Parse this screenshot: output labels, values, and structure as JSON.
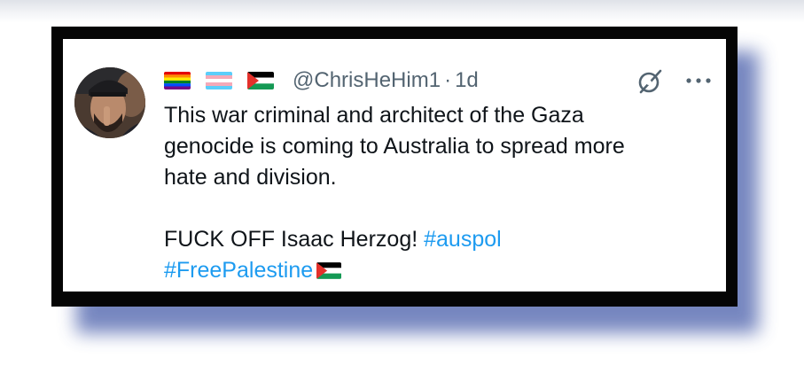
{
  "tweet": {
    "handle": "@ChrisHeHim1",
    "separator": "·",
    "time": "1d",
    "name_flags": [
      "rainbow-pride-flag-icon",
      "transgender-flag-icon",
      "palestine-flag-icon"
    ],
    "lines": [
      "This war criminal and architect of the Gaza",
      "genocide is coming to Australia to spread more",
      "hate and division."
    ],
    "line5_text": "FUCK OFF Isaac Herzog! ",
    "hashtag_1": "#auspol",
    "hashtag_2": "#FreePalestine",
    "trailing_flag": "palestine-flag-icon"
  },
  "colors": {
    "link": "#1d9bf0",
    "secondary_text": "#536471",
    "primary_text": "#0f1419",
    "frame": "#050505",
    "shadow": "#5f72b5"
  }
}
